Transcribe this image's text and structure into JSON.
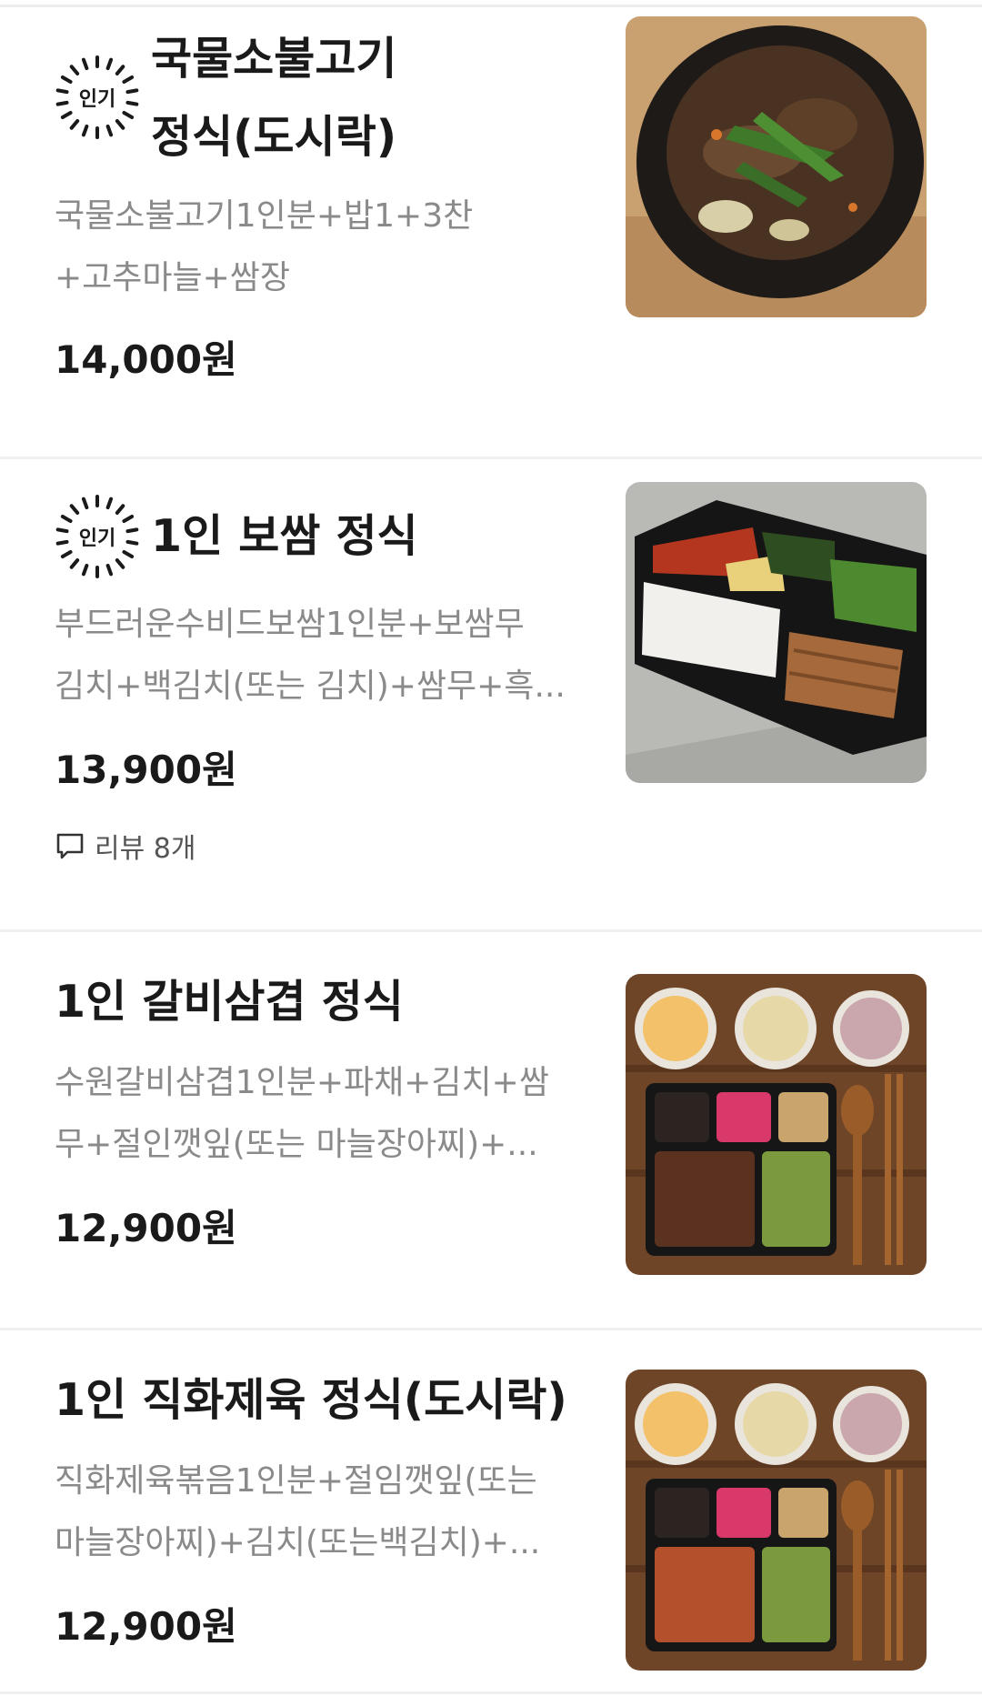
{
  "menu_items": [
    {
      "badge": "인기",
      "title_lines": [
        "국물소불고기",
        "정식(도시락)"
      ],
      "desc_lines": [
        "국물소불고기1인분+밥1+3찬",
        "+고추마늘+쌈장"
      ],
      "price": "14,000원",
      "photo_icon": "bulgogi-hotpot-photo"
    },
    {
      "badge": "인기",
      "title_lines": [
        "1인 보쌈 정식"
      ],
      "desc_lines": [
        "부드러운수비드보쌈1인분+보쌈무",
        "김치+백김치(또는 김치)+쌈무+흑..."
      ],
      "price": "13,900원",
      "review": "리뷰 8개",
      "photo_icon": "bossam-lunchbox-photo"
    },
    {
      "title_lines": [
        "1인 갈비삼겹 정식"
      ],
      "desc_lines": [
        "수원갈비삼겹1인분+파채+김치+쌈",
        "무+절인깻잎(또는 마늘장아찌)+..."
      ],
      "price": "12,900원",
      "photo_icon": "galbi-samgyeop-set-photo"
    },
    {
      "title_lines": [
        "1인 직화제육 정식(도시락)"
      ],
      "desc_lines": [
        "직화제육볶음1인분+절임깻잎(또는",
        "마늘장아찌)+김치(또는백김치)+..."
      ],
      "price": "12,900원",
      "photo_icon": "jeyuk-set-photo"
    }
  ],
  "colors": {
    "text": "#1a1a1a",
    "desc": "#8a8a8a",
    "divider": "#f0f0f0"
  }
}
